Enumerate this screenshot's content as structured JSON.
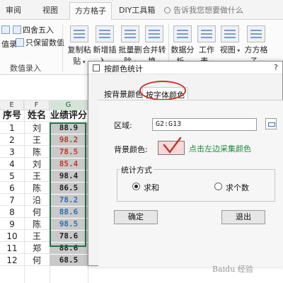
{
  "ribbon": {
    "tabs": [
      "审阅",
      "视图",
      "方方格子",
      "DIY工具箱"
    ],
    "active_tab": "方方格子",
    "tell_me": "告诉我您想要做什么",
    "small_items": [
      "四舍五入",
      "只保留数值"
    ],
    "clipped_left": "值录",
    "group_label": "数值录入",
    "groups": [
      {
        "label": "复制粘",
        "sub": "贴"
      },
      {
        "label": "新增插",
        "sub": "入"
      },
      {
        "label": "批量删",
        "sub": "除"
      },
      {
        "label": "合并转",
        "sub": "换"
      },
      {
        "label": "数据分",
        "sub": "析"
      },
      {
        "label": "工作",
        "sub": "表"
      },
      {
        "label": "视图",
        "sub": ""
      },
      {
        "label": "方方格",
        "sub": "子"
      }
    ]
  },
  "sheet": {
    "columns": [
      "E",
      "F",
      "G"
    ],
    "selected_column": "G",
    "header": [
      "序号",
      "姓名",
      "业绩评分"
    ],
    "rows": [
      {
        "n": "1",
        "name": "刘",
        "score": "88.9",
        "color": "#1f1f1f"
      },
      {
        "n": "2",
        "name": "王",
        "score": "98.2",
        "color": "#c0392b"
      },
      {
        "n": "3",
        "name": "陈",
        "score": "78.5",
        "color": "#c0392b"
      },
      {
        "n": "4",
        "name": "刘",
        "score": "85.4",
        "color": "#c0392b"
      },
      {
        "n": "5",
        "name": "王",
        "score": "98.4",
        "color": "#1f1f1f"
      },
      {
        "n": "6",
        "name": "陈",
        "score": "86.5",
        "color": "#1f1f1f"
      },
      {
        "n": "7",
        "name": "沿",
        "score": "78.2",
        "color": "#2e6db4"
      },
      {
        "n": "8",
        "name": "何",
        "score": "88.6",
        "color": "#2e6db4"
      },
      {
        "n": "9",
        "name": "陈",
        "score": "98.5",
        "color": "#2e6db4"
      },
      {
        "n": "10",
        "name": "王",
        "score": "78.6",
        "color": "#1f1f1f"
      },
      {
        "n": "11",
        "name": "郑",
        "score": "88.6",
        "color": "#1f1f1f"
      },
      {
        "n": "12",
        "name": "何",
        "score": "68.5",
        "color": "#1f1f1f"
      }
    ]
  },
  "dialog": {
    "title": "按颜色统计",
    "help": "?",
    "tabs": [
      "按背景颜色",
      "按字体颜色"
    ],
    "active_tab": "按字体颜色",
    "area_label": "区域:",
    "area_value": "G2:G13",
    "bg_color_label": "背景颜色:",
    "swatch_color": "#f8d8d8",
    "hint": "点击左边采集颜色",
    "method_legend": "统计方式",
    "options": [
      "求和",
      "求个数"
    ],
    "selected_option": "求和",
    "ok": "确定",
    "exit": "退出"
  },
  "colors": {
    "accent": "#217346",
    "annotation_red": "#c0392b",
    "hint_green": "#1a8a3a"
  },
  "watermark": "Baidu 经验"
}
